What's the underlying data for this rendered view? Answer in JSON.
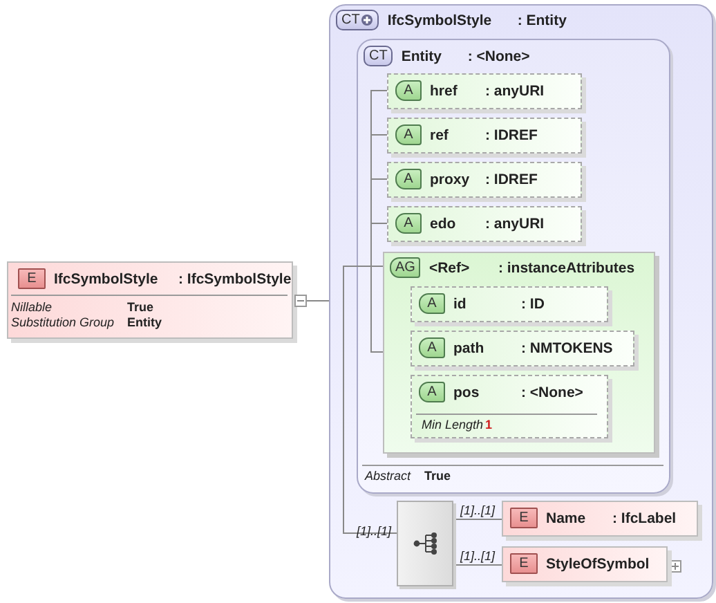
{
  "element": {
    "badge": "E",
    "name": "IfcSymbolStyle",
    "type": ": IfcSymbolStyle",
    "expanded": true,
    "properties": [
      {
        "label": "Nillable",
        "value": "True"
      },
      {
        "label": "Substitution Group",
        "value": "Entity"
      }
    ]
  },
  "complex_type": {
    "badge": "CT",
    "name": "IfcSymbolStyle",
    "type": ": Entity",
    "base": {
      "badge": "CT",
      "name": "Entity",
      "type": ": <None>",
      "attributes": [
        {
          "badge": "A",
          "name": "href",
          "type": ": anyURI"
        },
        {
          "badge": "A",
          "name": "ref",
          "type": ": IDREF"
        },
        {
          "badge": "A",
          "name": "proxy",
          "type": ": IDREF"
        },
        {
          "badge": "A",
          "name": "edo",
          "type": ": anyURI"
        }
      ],
      "attribute_group": {
        "badge": "AG",
        "name": "<Ref>",
        "type": ": instanceAttributes",
        "attributes": [
          {
            "badge": "A",
            "name": "id",
            "type": ": ID"
          },
          {
            "badge": "A",
            "name": "path",
            "type": ": NMTOKENS"
          },
          {
            "badge": "A",
            "name": "pos",
            "type": ": <None>",
            "properties": [
              {
                "label": "Min Length",
                "value": "1"
              }
            ]
          }
        ]
      },
      "properties": [
        {
          "label": "Abstract",
          "value": "True"
        }
      ]
    },
    "sequence": {
      "multiplicity": "[1]..[1]",
      "elements": [
        {
          "badge": "E",
          "multiplicity": "[1]..[1]",
          "name": "Name",
          "type": ": IfcLabel",
          "expandable": false
        },
        {
          "badge": "E",
          "multiplicity": "[1]..[1]",
          "name": "StyleOfSymbol",
          "expandable": true
        }
      ]
    }
  }
}
